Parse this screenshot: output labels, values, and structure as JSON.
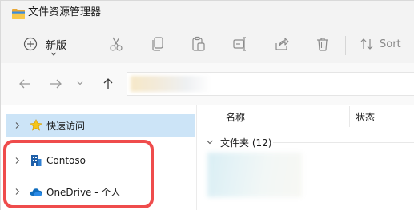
{
  "window": {
    "title": "文件资源管理器"
  },
  "toolbar": {
    "new_label": "新版",
    "sort_label": "Sort",
    "tools": [
      "cut-icon",
      "copy-icon",
      "paste-icon",
      "rename-icon",
      "share-icon",
      "delete-icon"
    ]
  },
  "nav": {
    "address_value": ""
  },
  "sidebar": {
    "items": [
      {
        "label": "快速访问",
        "icon": "star-icon",
        "selected": true
      },
      {
        "label": "Contoso",
        "icon": "building-icon",
        "selected": false
      },
      {
        "label": "OneDrive - 个人",
        "icon": "onedrive-cloud-icon",
        "selected": false
      }
    ]
  },
  "content": {
    "columns": [
      "名称",
      "状态"
    ],
    "group_label": "文件夹 (12)"
  },
  "colors": {
    "selected_bg": "#cce4f7",
    "highlight_border": "#ef4c4c",
    "folder_yellow": "#f8c84a",
    "onedrive_blue": "#0f6cbd"
  }
}
